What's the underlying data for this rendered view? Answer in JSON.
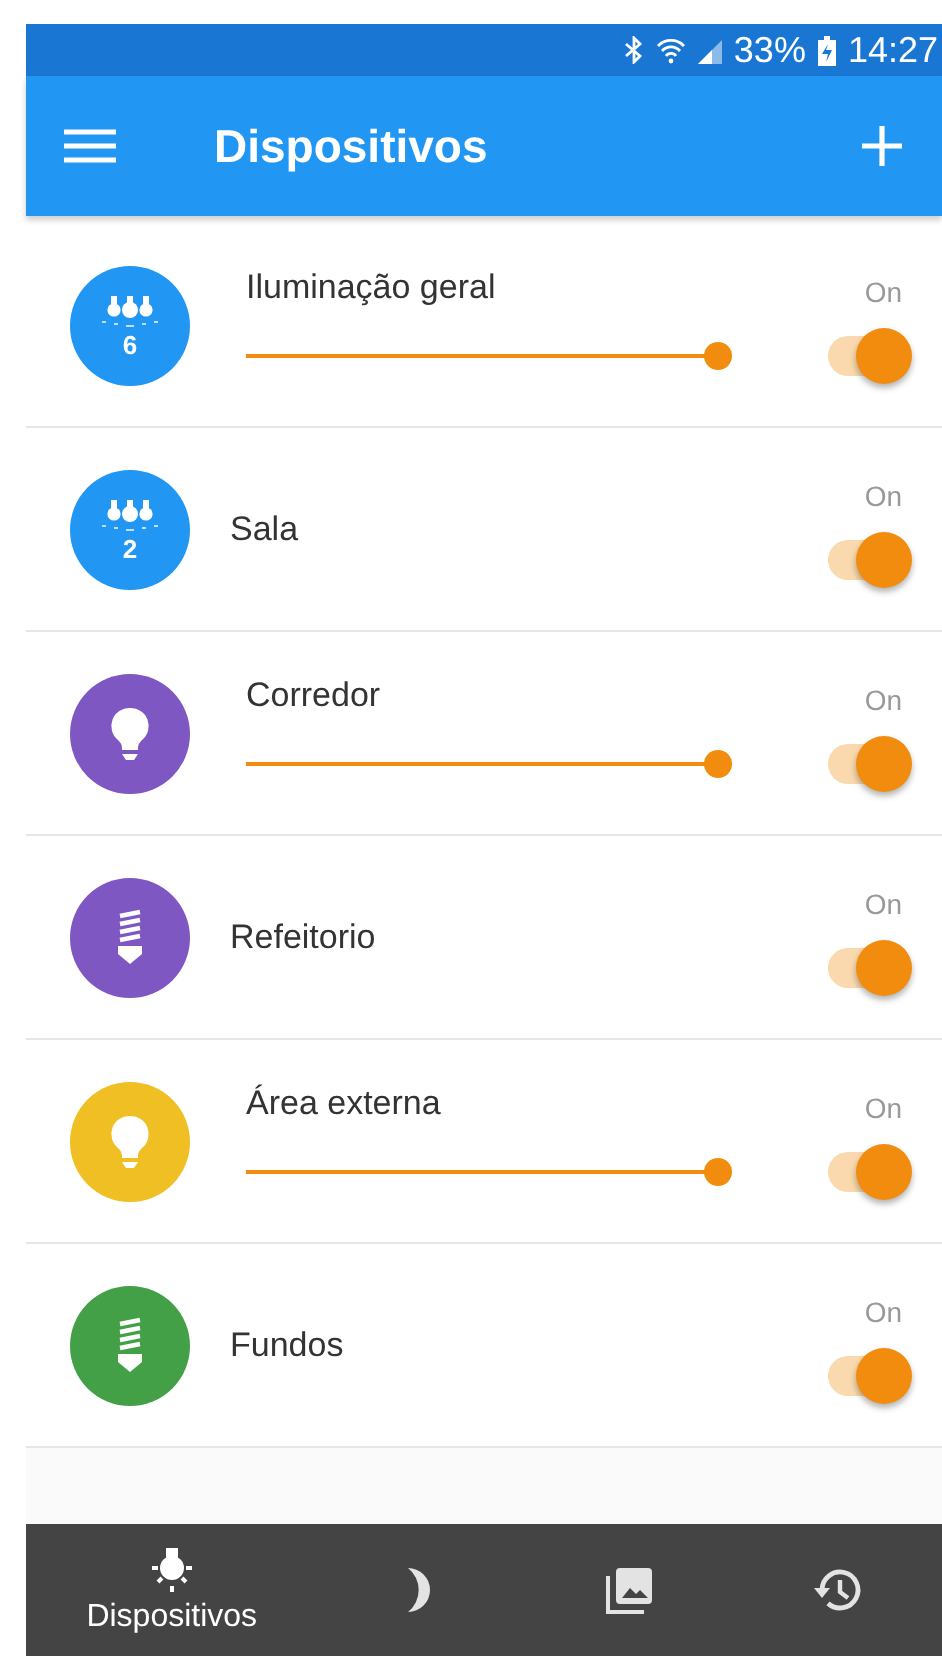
{
  "status_bar": {
    "battery": "33%",
    "time": "14:27"
  },
  "app_bar": {
    "title": "Dispositivos"
  },
  "devices": [
    {
      "name": "Iluminação geral",
      "kind": "group",
      "count": "6",
      "color": "#2196f3",
      "level": 0.97,
      "on": true,
      "state_label": "On"
    },
    {
      "name": "Sala",
      "kind": "group",
      "count": "2",
      "color": "#2196f3",
      "on": true,
      "state_label": "On"
    },
    {
      "name": "Corredor",
      "kind": "bulb",
      "color": "#7e57c2",
      "level": 0.97,
      "on": true,
      "state_label": "On"
    },
    {
      "name": "Refeitorio",
      "kind": "cfl",
      "color": "#7e57c2",
      "on": true,
      "state_label": "On"
    },
    {
      "name": "Área externa",
      "kind": "bulb",
      "color": "#f0bf24",
      "level": 0.97,
      "on": true,
      "state_label": "On"
    },
    {
      "name": "Fundos",
      "kind": "cfl",
      "color": "#43a047",
      "on": true,
      "state_label": "On"
    }
  ],
  "bottom_nav": [
    {
      "kind": "devices",
      "label": "Dispositivos",
      "selected": true
    },
    {
      "kind": "moon",
      "selected": false
    },
    {
      "kind": "gallery",
      "selected": false
    },
    {
      "kind": "history",
      "selected": false
    }
  ]
}
